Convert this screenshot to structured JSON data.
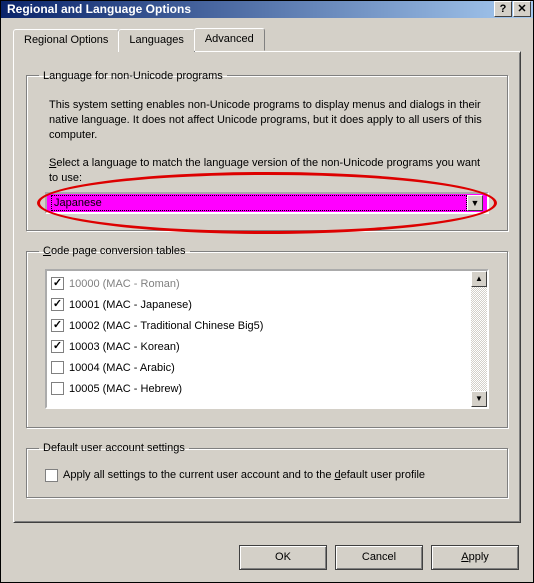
{
  "window": {
    "title": "Regional and Language Options"
  },
  "tabs": {
    "t0": "Regional Options",
    "t1": "Languages",
    "t2": "Advanced",
    "activeIndex": 2
  },
  "group1": {
    "legend": "Language for non-Unicode programs",
    "desc": "This system setting enables non-Unicode programs to display menus and dialogs in their native language. It does not affect Unicode programs, but it does apply to all users of this computer.",
    "prompt_pre": "S",
    "prompt_rest": "elect a language to match the language version of the non-Unicode programs you want to use:",
    "selected": "Japanese"
  },
  "group2": {
    "legend_pre": "C",
    "legend_rest": "ode page conversion tables",
    "items": [
      {
        "label": "10000 (MAC - Roman)",
        "checked": true,
        "disabled": true
      },
      {
        "label": "10001 (MAC - Japanese)",
        "checked": true,
        "disabled": false
      },
      {
        "label": "10002 (MAC - Traditional Chinese Big5)",
        "checked": true,
        "disabled": false
      },
      {
        "label": "10003 (MAC - Korean)",
        "checked": true,
        "disabled": false
      },
      {
        "label": "10004 (MAC - Arabic)",
        "checked": false,
        "disabled": false
      },
      {
        "label": "10005 (MAC - Hebrew)",
        "checked": false,
        "disabled": false
      }
    ]
  },
  "group3": {
    "legend": "Default user account settings",
    "check_pre": "Apply all settings to the current user account and to the ",
    "check_u": "d",
    "check_post": "efault user profile",
    "checked": false
  },
  "buttons": {
    "ok": "OK",
    "cancel": "Cancel",
    "apply_pre": "A",
    "apply_rest": "pply"
  }
}
